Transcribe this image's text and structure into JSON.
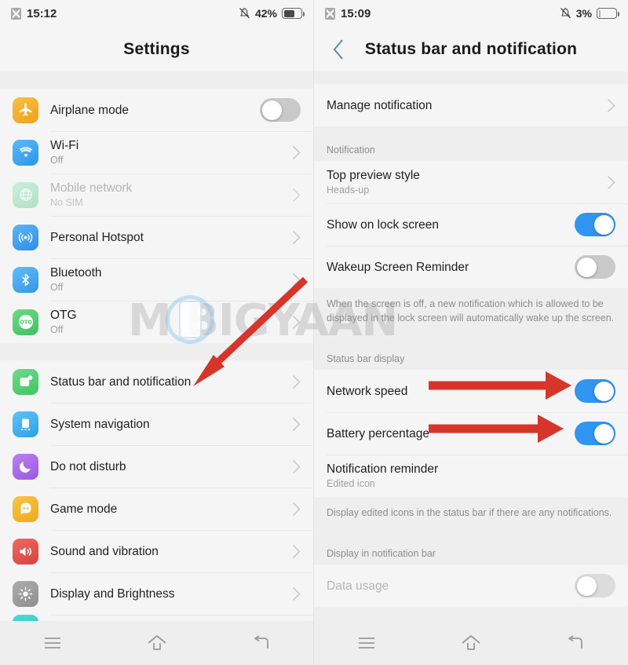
{
  "colors": {
    "accent_blue": "#2f95f0",
    "arrow_red": "#d8352a",
    "bg_gray": "#eeeeee",
    "panel": "#f5f5f5"
  },
  "left_panel": {
    "status_bar": {
      "time": "15:12",
      "battery_percent": "42%",
      "sim_icon": "sim-card-off-icon",
      "bell_icon": "bell-muted-icon"
    },
    "title": "Settings",
    "items": [
      {
        "label": "Airplane mode",
        "sub": "",
        "icon": "airplane-icon",
        "icon_color": "#f5ab2b",
        "control": "toggle-off"
      },
      {
        "label": "Wi-Fi",
        "sub": "Off",
        "icon": "wifi-icon",
        "icon_color": "#3fa9f5",
        "control": "chevron"
      },
      {
        "label": "Mobile network",
        "sub": "No SIM",
        "icon": "globe-icon",
        "icon_color": "#b6e5c9",
        "control": "chevron",
        "dimmed": true
      },
      {
        "label": "Personal Hotspot",
        "sub": "",
        "icon": "hotspot-icon",
        "icon_color": "#3f9ff0",
        "control": "chevron"
      },
      {
        "label": "Bluetooth",
        "sub": "Off",
        "icon": "bluetooth-icon",
        "icon_color": "#44a6ee",
        "control": "chevron"
      },
      {
        "label": "OTG",
        "sub": "Off",
        "icon": "otg-icon",
        "icon_color": "#4cc96a",
        "control": "chevron"
      }
    ],
    "items2": [
      {
        "label": "Status bar and notification",
        "sub": "",
        "icon": "status-bar-icon",
        "icon_color": "#4ecb71",
        "control": "chevron"
      },
      {
        "label": "System navigation",
        "sub": "",
        "icon": "system-navigation-icon",
        "icon_color": "#3eb0ef",
        "control": "chevron"
      },
      {
        "label": "Do not disturb",
        "sub": "",
        "icon": "moon-icon",
        "icon_color": "#a767e8",
        "control": "chevron"
      },
      {
        "label": "Game mode",
        "sub": "",
        "icon": "game-mode-icon",
        "icon_color": "#f0b22e",
        "control": "chevron"
      },
      {
        "label": "Sound and vibration",
        "sub": "",
        "icon": "speaker-icon",
        "icon_color": "#e0524e",
        "control": "chevron"
      },
      {
        "label": "Display and Brightness",
        "sub": "",
        "icon": "brightness-icon",
        "icon_color": "#9c9c9c",
        "control": "chevron"
      }
    ]
  },
  "right_panel": {
    "status_bar": {
      "time": "15:09",
      "battery_percent": "3%",
      "sim_icon": "sim-card-off-icon",
      "bell_icon": "bell-muted-icon"
    },
    "title": "Status bar and notification",
    "back_icon": "chevron-left-icon",
    "manage": {
      "label": "Manage notification",
      "control": "chevron"
    },
    "section_notification": "Notification",
    "notification_items": [
      {
        "label": "Top preview style",
        "sub": "Heads-up",
        "control": "chevron"
      },
      {
        "label": "Show on lock screen",
        "sub": "",
        "control": "toggle-on"
      },
      {
        "label": "Wakeup Screen Reminder",
        "sub": "",
        "control": "toggle-off"
      }
    ],
    "wakeup_footnote": "When the screen is off, a new notification which is allowed to be displayed in the lock screen will automatically wake up the screen.",
    "section_status_bar_display": "Status bar display",
    "status_items": [
      {
        "label": "Network speed",
        "sub": "",
        "control": "toggle-on"
      },
      {
        "label": "Battery percentage",
        "sub": "",
        "control": "toggle-on"
      },
      {
        "label": "Notification reminder",
        "sub": "Edited icon",
        "control": "none"
      }
    ],
    "edited_footnote": "Display edited icons in the status bar if there are any notifications.",
    "section_display_in_notification_bar": "Display in notification bar",
    "display_items": [
      {
        "label": "Data usage",
        "sub": "",
        "control": "toggle-off",
        "dimmed": true
      }
    ]
  },
  "nav_bar": {
    "buttons": [
      {
        "name": "recents-button",
        "icon": "menu-icon"
      },
      {
        "name": "home-button",
        "icon": "home-icon"
      },
      {
        "name": "back-button",
        "icon": "back-arrow-icon"
      }
    ]
  },
  "watermark": {
    "text": "M BIGYAAN",
    "logo": "phone-in-circle-icon"
  },
  "annotations": [
    {
      "name": "arrow-to-status-bar-and-notification",
      "type": "diagonal-arrow"
    },
    {
      "name": "arrow-to-network-speed-toggle",
      "type": "horizontal-arrow"
    },
    {
      "name": "arrow-to-battery-percentage-toggle",
      "type": "horizontal-arrow"
    }
  ]
}
